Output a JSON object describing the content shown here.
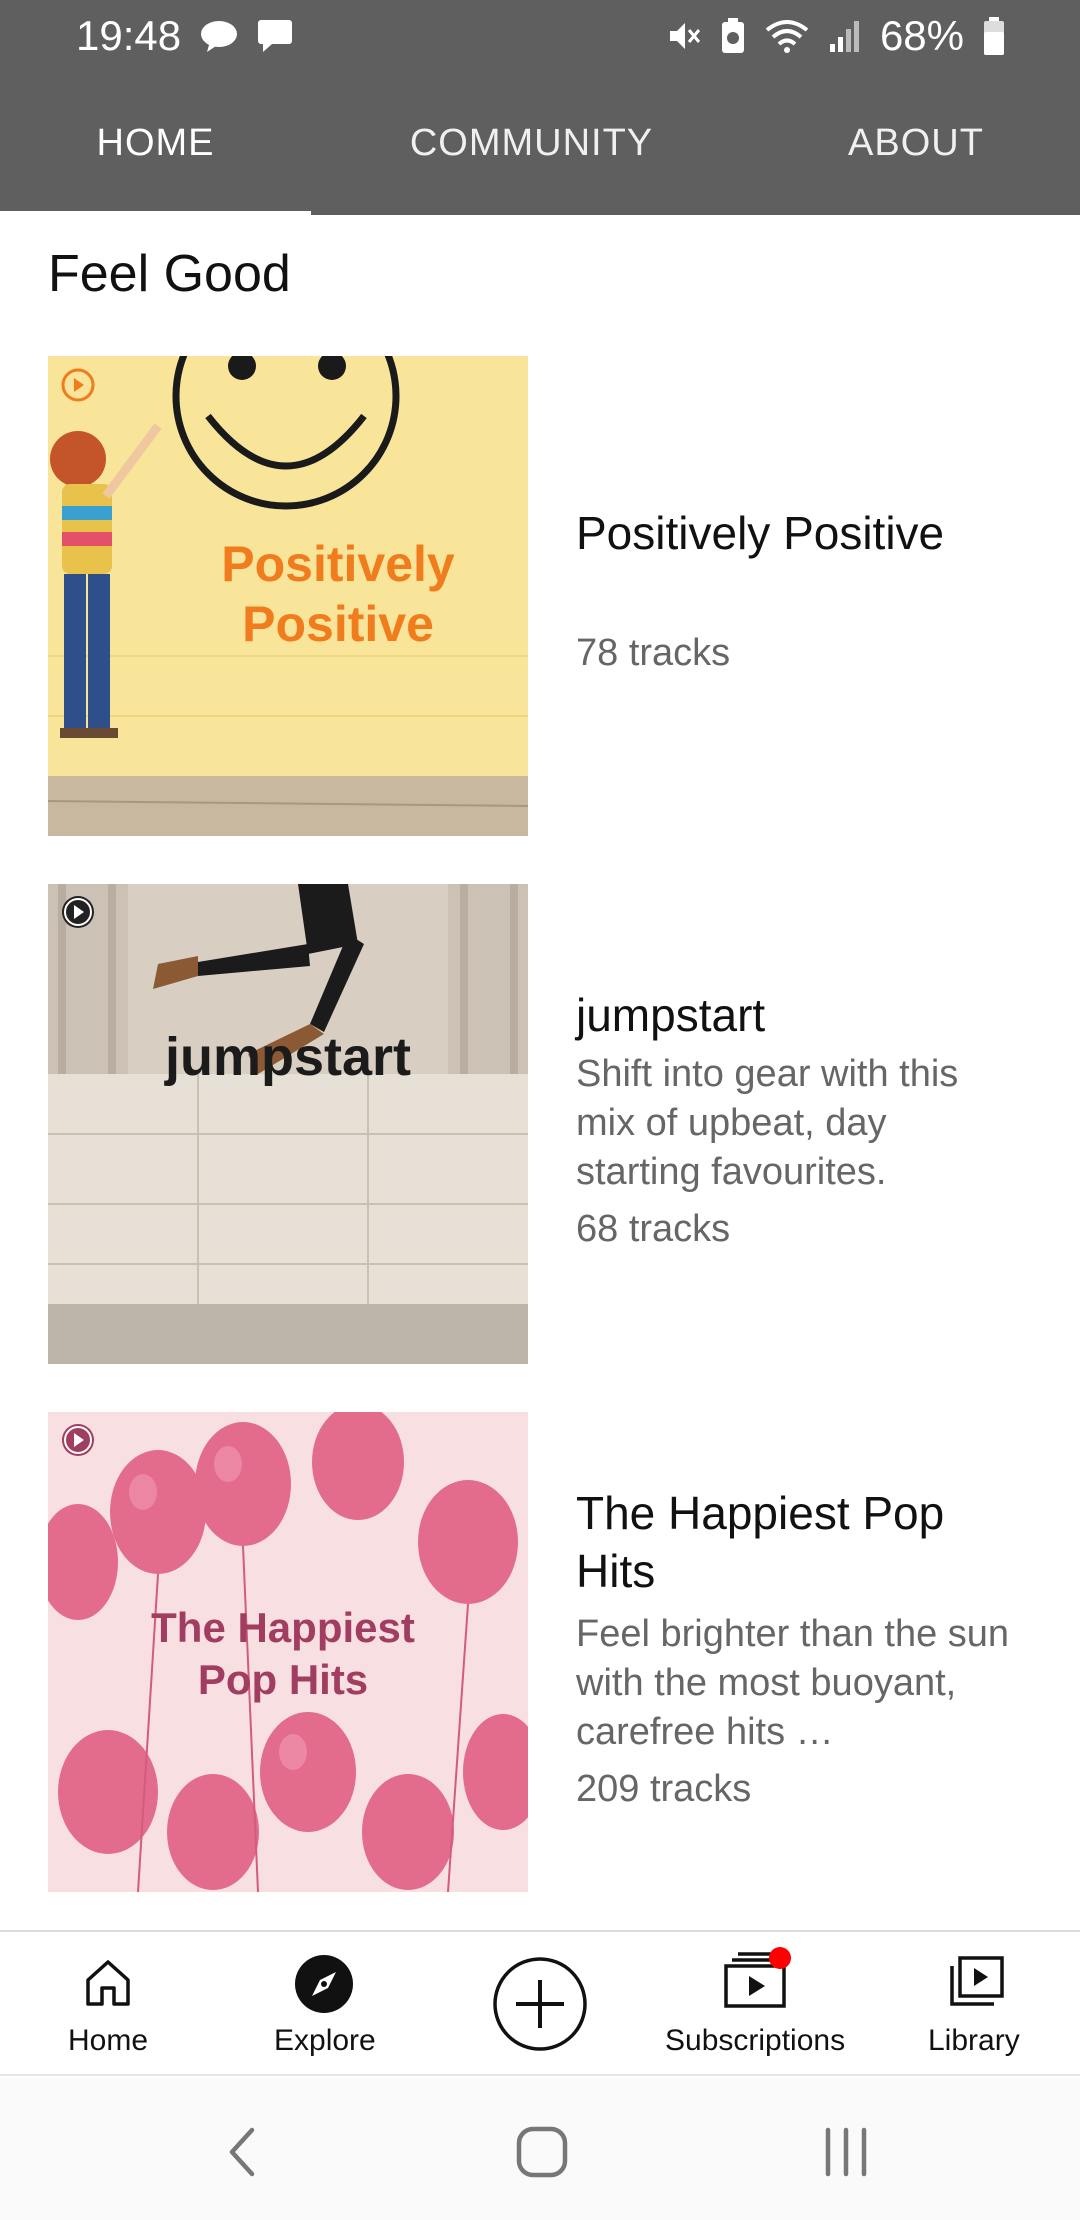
{
  "status_bar": {
    "time": "19:48",
    "battery": "68%",
    "icons": [
      "talk-icon",
      "message-icon",
      "mute-icon",
      "battery-saver-icon",
      "wifi-icon",
      "signal-icon",
      "battery-icon"
    ]
  },
  "tabs": [
    {
      "label": "HOME",
      "active": true
    },
    {
      "label": "COMMUNITY",
      "active": false
    },
    {
      "label": "ABOUT",
      "active": false
    }
  ],
  "section": {
    "title": "Feel Good"
  },
  "playlists": [
    {
      "title": "Positively Positive",
      "description": "",
      "tracks": "78 tracks",
      "cover_text_line1": "Positively",
      "cover_text_line2": "Positive"
    },
    {
      "title": "jumpstart",
      "description": "Shift into gear with this mix of upbeat, day starting favourites.",
      "tracks": "68 tracks",
      "cover_text_line1": "jumpstart"
    },
    {
      "title": "The Happiest Pop Hits",
      "description": "Feel brighter than the sun with the most buoyant, carefree hits …",
      "tracks": "209 tracks",
      "cover_text_line1": "The Happiest",
      "cover_text_line2": "Pop Hits"
    }
  ],
  "bottom_nav": {
    "home": "Home",
    "explore": "Explore",
    "add": "",
    "subscriptions": "Subscriptions",
    "library": "Library"
  },
  "colors": {
    "header": "#5f5f5f",
    "cover1_bg": "#f8e59a",
    "cover1_text": "#f07c1e",
    "cover2_bg": "#d9d0c4",
    "cover3_bg": "#f7d9dc",
    "cover3_text": "#a13d60",
    "notification_dot": "#ff0000"
  }
}
